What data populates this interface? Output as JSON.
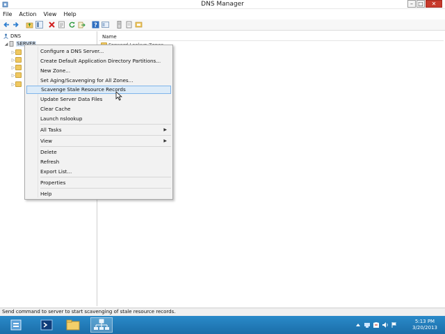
{
  "window": {
    "title": "DNS Manager",
    "controls": {
      "minimize": "–",
      "maximize": "□",
      "close": "✕"
    }
  },
  "menubar": [
    "File",
    "Action",
    "View",
    "Help"
  ],
  "toolbar": {
    "icons": [
      "back-arrow-icon",
      "forward-arrow-icon",
      "folder-up-icon",
      "show-tree-icon",
      "delete-icon",
      "properties-icon",
      "refresh-icon",
      "export-icon",
      "help-icon",
      "console-icon",
      "server-icon",
      "record-icon",
      "zone-icon"
    ]
  },
  "tree": {
    "root": "DNS",
    "server": "SERVER",
    "expander_collapsed": "▷",
    "expander_expanded": "◢"
  },
  "list": {
    "column_name": "Name",
    "partial_item": "Forward Lookup Zones"
  },
  "context_menu": {
    "items": [
      {
        "label": "Configure a DNS Server...",
        "submenu": false
      },
      {
        "label": "Create Default Application Directory Partitions...",
        "submenu": false
      },
      {
        "label": "New Zone...",
        "submenu": false
      },
      {
        "label": "Set Aging/Scavenging for All Zones...",
        "submenu": false
      },
      {
        "label": "Scavenge Stale Resource Records",
        "submenu": false,
        "highlighted": true
      },
      {
        "label": "Update Server Data Files",
        "submenu": false
      },
      {
        "label": "Clear Cache",
        "submenu": false
      },
      {
        "label": "Launch nslookup",
        "submenu": false
      },
      {
        "label": "All Tasks",
        "submenu": true
      },
      {
        "label": "View",
        "submenu": true
      },
      {
        "label": "Delete",
        "submenu": false
      },
      {
        "label": "Refresh",
        "submenu": false
      },
      {
        "label": "Export List...",
        "submenu": false
      },
      {
        "label": "Properties",
        "submenu": false
      },
      {
        "label": "Help",
        "submenu": false
      }
    ],
    "submenu_arrow": "▶"
  },
  "statusbar": {
    "text": "Send command to server to start scavenging of stale resource records."
  },
  "taskbar": {
    "apps": [
      "server-manager-icon",
      "powershell-icon",
      "file-explorer-icon",
      "dns-manager-icon"
    ],
    "tray": [
      "tray-arrow-icon",
      "network-icon",
      "action-center-icon",
      "volume-icon",
      "flag-icon"
    ],
    "time": "5:13 PM",
    "date": "3/20/2013"
  },
  "colors": {
    "accent": "#2a8ac9",
    "highlight": "#dcebf8",
    "close": "#c7392b"
  }
}
